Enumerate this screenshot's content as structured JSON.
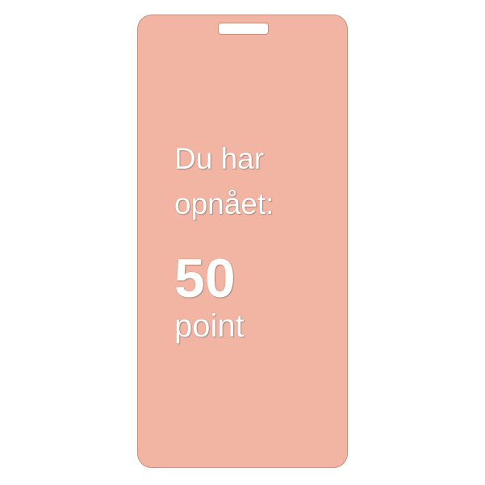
{
  "card": {
    "background_color": "#f2b5a3",
    "line1": "Du har",
    "line2": "opnået:",
    "points_value": "50",
    "points_unit": "point"
  }
}
